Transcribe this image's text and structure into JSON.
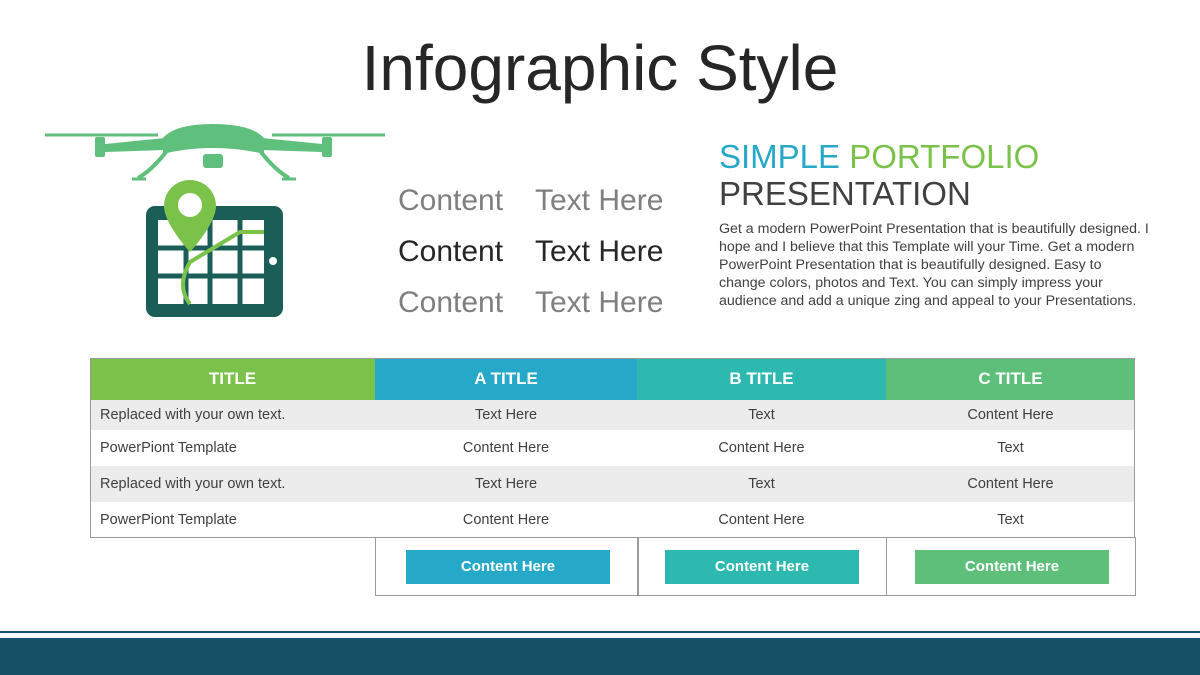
{
  "title": "Infographic Style",
  "colors": {
    "green": "#7bc24b",
    "blue": "#26a9c8",
    "teal": "#2db8b0",
    "mint": "#5dbf7a",
    "navy": "#155067",
    "drone_green": "#5fbf7c",
    "tablet": "#1b5e58",
    "pin": "#7bc24b"
  },
  "illustration": {
    "icons": [
      "drone-icon",
      "map-pin-icon",
      "tablet-map-icon"
    ]
  },
  "middle_list": [
    {
      "col1": "Content",
      "col2": "Text Here"
    },
    {
      "col1": "Content",
      "col2": "Text Here"
    },
    {
      "col1": "Content",
      "col2": "Text Here"
    }
  ],
  "portfolio": {
    "heading_part1": "SIMPLE",
    "heading_part2": "PORTFOLIO",
    "heading_line2": "PRESENTATION",
    "description": "Get a modern PowerPoint  Presentation that is beautifully designed. I hope and I believe that this Template will your Time. Get a modern PowerPoint  Presentation that is beautifully designed.  Easy to change colors, photos and Text. You can simply impress your audience and add a unique zing and appeal to your Presentations."
  },
  "table": {
    "headers": [
      "TITLE",
      "A TITLE",
      "B TITLE",
      "C TITLE"
    ],
    "rows": [
      [
        "Replaced with your own text.",
        "Text Here",
        "Text",
        "Content Here"
      ],
      [
        "PowerPiont Template",
        "Content Here",
        "Content Here",
        "Text"
      ],
      [
        "Replaced with your own text.",
        "Text Here",
        "Text",
        "Content Here"
      ],
      [
        "PowerPiont Template",
        "Content Here",
        "Content Here",
        "Text"
      ]
    ],
    "buttons": [
      "Content Here",
      "Content Here",
      "Content Here"
    ]
  }
}
